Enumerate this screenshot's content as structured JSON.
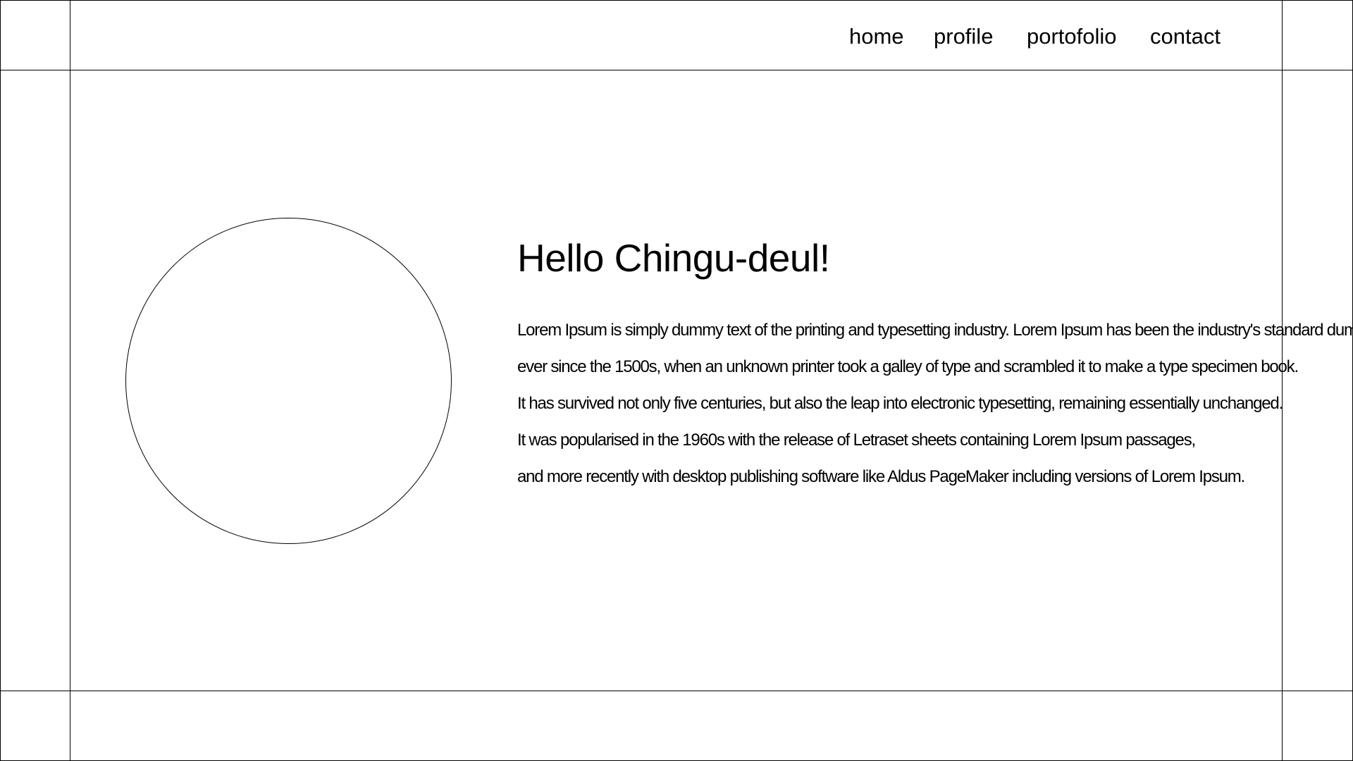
{
  "nav": {
    "items": [
      {
        "label": "home"
      },
      {
        "label": "profile"
      },
      {
        "label": "portofolio"
      },
      {
        "label": "contact"
      }
    ]
  },
  "hero": {
    "heading": "Hello Chingu-deul!",
    "paragraph_lines": [
      "Lorem Ipsum is simply dummy text of the printing and typesetting industry. Lorem Ipsum has been the industry's standard dummy text",
      "ever since the 1500s, when an unknown printer took a galley of type and scrambled it to make a type specimen book.",
      "It has survived not only five centuries, but also the leap into electronic typesetting, remaining essentially unchanged.",
      "It was popularised in the 1960s with the release of Letraset sheets containing Lorem Ipsum passages,",
      "and more recently with desktop publishing software like Aldus PageMaker including versions of Lorem Ipsum."
    ]
  },
  "colors": {
    "background": "#ffffff",
    "line": "#000000",
    "text": "#000000"
  }
}
